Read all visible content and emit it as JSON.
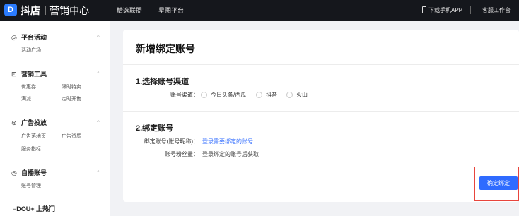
{
  "topbar": {
    "logo_glyph": "D",
    "brand": "抖店",
    "sub_brand": "营销中心",
    "nav": [
      "精选联盟",
      "星图平台"
    ],
    "download_app": "下载手机APP",
    "service": "客服工作台"
  },
  "sidebar": {
    "sections": [
      {
        "icon": "◎",
        "title": "平台活动",
        "items": [
          "活动广场"
        ]
      },
      {
        "icon": "⊡",
        "title": "营销工具",
        "items": [
          "优惠券",
          "限时特卖",
          "满减",
          "定时开售"
        ]
      },
      {
        "icon": "⊚",
        "title": "广告投放",
        "items": [
          "广告落地页",
          "广告资质",
          "服务指标"
        ]
      },
      {
        "icon": "◎",
        "title": "自播账号",
        "items": [
          "账号管理"
        ]
      }
    ],
    "dou_plus": "≡DOU+ 上热门",
    "chevron": "^"
  },
  "main": {
    "title": "新增绑定账号",
    "section1": {
      "heading": "1.选择账号渠道",
      "label": "账号渠道：",
      "options": [
        "今日头条/西瓜",
        "抖音",
        "火山"
      ]
    },
    "section2": {
      "heading": "2.绑定账号",
      "bind_label": "绑定账号(账号昵称)：",
      "bind_link": "登录需要绑定的账号",
      "fans_label": "账号粉丝量：",
      "fans_value": "登录绑定的账号后获取"
    },
    "confirm_button": "确定绑定"
  },
  "colors": {
    "topbar_bg": "#15171c",
    "accent": "#2f6bff",
    "highlight_border": "#e8453c"
  }
}
